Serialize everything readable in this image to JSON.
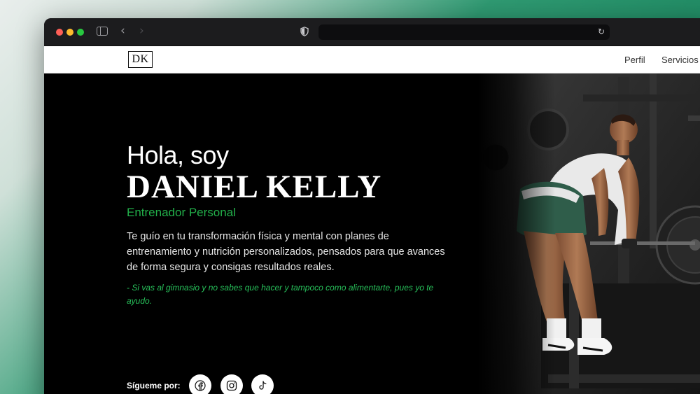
{
  "nav": {
    "logo": "DK",
    "links": [
      "Perfil",
      "Servicios"
    ]
  },
  "hero": {
    "greeting": "Hola, soy",
    "name": "DANIEL KELLY",
    "role": "Entrenador Personal",
    "description": "Te guío en tu transformación física y mental con planes de entrenamiento y nutrición personalizados, pensados para que avances de forma segura y consigas resultados reales.",
    "quote": "- Si vas al gimnasio y no sabes que hacer y tampoco como alimentarte, pues yo te ayudo.",
    "follow_label": "Sígueme por:",
    "socials": [
      "facebook-icon",
      "instagram-icon",
      "tiktok-icon"
    ]
  },
  "colors": {
    "accent": "#22b04a",
    "background": "#000000",
    "nav_bg": "#ffffff"
  }
}
